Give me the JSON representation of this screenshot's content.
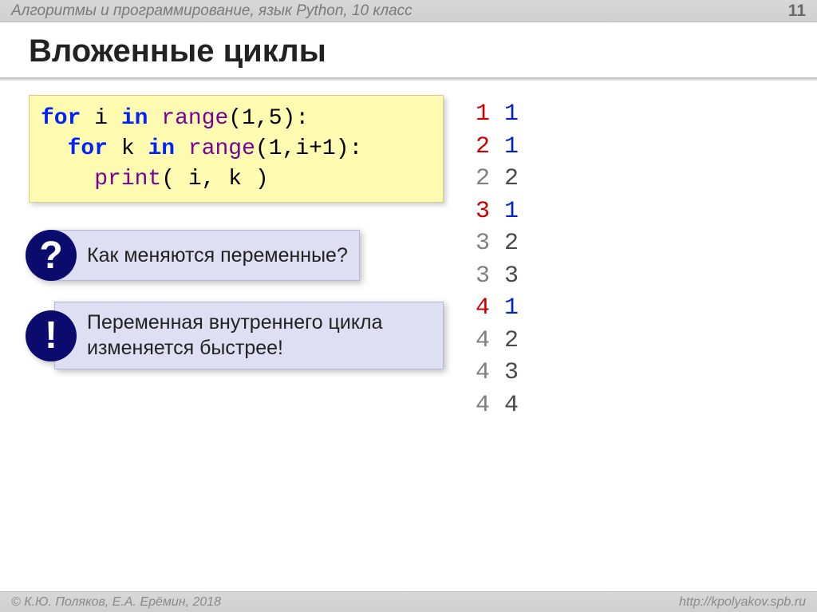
{
  "header": {
    "course": "Алгоритмы и программирование, язык Python, 10 класс",
    "page_number": "11"
  },
  "title": "Вложенные циклы",
  "code": {
    "line1": {
      "kw_for": "for",
      "var": "i",
      "kw_in": "in",
      "fn": "range",
      "args": "(1,5)",
      "colon": ":"
    },
    "line2": {
      "indent": "  ",
      "kw_for": "for",
      "var": "k",
      "kw_in": "in",
      "fn": "range",
      "args": "(1,i+1)",
      "colon": ":"
    },
    "line3": {
      "indent": "    ",
      "fn": "print",
      "args": "( i, k )"
    }
  },
  "callouts": {
    "question": {
      "badge": "?",
      "text": "Как меняются переменные?"
    },
    "answer": {
      "badge": "!",
      "text": "Переменная внутреннего цикла изменяется быстрее!"
    }
  },
  "output_rows": [
    {
      "i": "1",
      "k": "1",
      "i_style": "first",
      "k_style": "first"
    },
    {
      "i": "2",
      "k": "1",
      "i_style": "first",
      "k_style": "first"
    },
    {
      "i": "2",
      "k": "2",
      "i_style": "rest",
      "k_style": "rest"
    },
    {
      "i": "3",
      "k": "1",
      "i_style": "first",
      "k_style": "first"
    },
    {
      "i": "3",
      "k": "2",
      "i_style": "rest",
      "k_style": "rest"
    },
    {
      "i": "3",
      "k": "3",
      "i_style": "rest",
      "k_style": "rest"
    },
    {
      "i": "4",
      "k": "1",
      "i_style": "first",
      "k_style": "first"
    },
    {
      "i": "4",
      "k": "2",
      "i_style": "rest",
      "k_style": "rest"
    },
    {
      "i": "4",
      "k": "3",
      "i_style": "rest",
      "k_style": "rest"
    },
    {
      "i": "4",
      "k": "4",
      "i_style": "rest",
      "k_style": "rest"
    }
  ],
  "footer": {
    "copyright": "© К.Ю. Поляков, Е.А. Ерёмин, 2018",
    "url": "http://kpolyakov.spb.ru"
  }
}
